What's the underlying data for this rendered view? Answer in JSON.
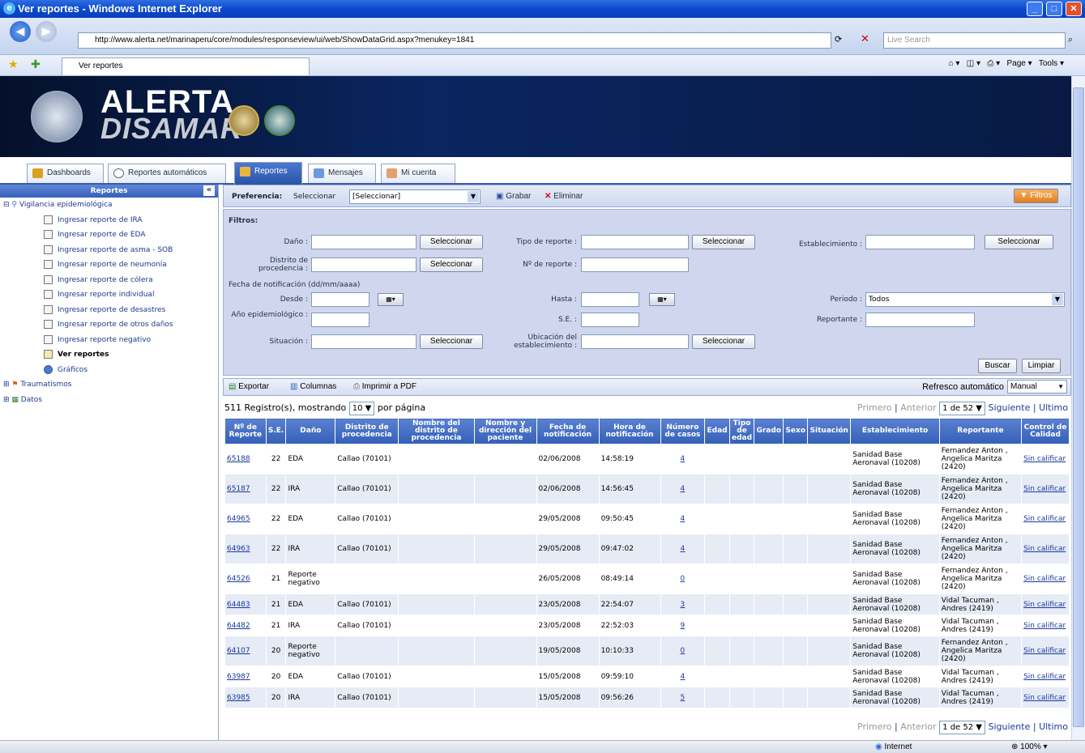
{
  "window": {
    "title": "Ver reportes - Windows Internet Explorer"
  },
  "browser": {
    "url": "http://www.alerta.net/marinaperu/core/modules/responseview/ui/web/ShowDataGrid.aspx?menukey=1841",
    "search_placeholder": "Live Search",
    "tab_title": "Ver reportes",
    "page_menu": "Page",
    "tools_menu": "Tools"
  },
  "banner": {
    "line1": "ALERTA",
    "line2": "DISAMAR"
  },
  "tabs": [
    {
      "label": "Dashboards"
    },
    {
      "label": "Reportes automáticos"
    },
    {
      "label": "Reportes"
    },
    {
      "label": "Mensajes"
    },
    {
      "label": "Mi cuenta"
    }
  ],
  "sidebar": {
    "title": "Reportes",
    "collapse": "«",
    "root": "Vigilancia epidemiológica",
    "items": [
      {
        "label": "Ingresar reporte de IRA"
      },
      {
        "label": "Ingresar reporte de EDA"
      },
      {
        "label": "Ingresar reporte de asma - SOB"
      },
      {
        "label": "Ingresar reporte de neumonía"
      },
      {
        "label": "Ingresar reporte de cólera"
      },
      {
        "label": "Ingresar reporte individual"
      },
      {
        "label": "Ingresar reporte de desastres"
      },
      {
        "label": "Ingresar reporte de otros daños"
      },
      {
        "label": "Ingresar reporte negativo"
      },
      {
        "label": "Ver reportes"
      },
      {
        "label": "Gráficos"
      }
    ],
    "other": [
      {
        "label": "Traumatismos"
      },
      {
        "label": "Datos"
      }
    ]
  },
  "prefs": {
    "label": "Preferencia:",
    "select_label": "Seleccionar",
    "select_value": "[Seleccionar]",
    "save": "Grabar",
    "delete": "Eliminar",
    "filters_btn": "Filtros"
  },
  "filters": {
    "title": "Filtros:",
    "dano": "Daño :",
    "tipo": "Tipo de reporte :",
    "establecimiento": "Establecimiento :",
    "distrito": "Distrito de procedencia :",
    "numero": "Nº de reporte :",
    "fecha_title": "Fecha de notificación (dd/mm/aaaa)",
    "desde": "Desde :",
    "hasta": "Hasta :",
    "periodo": "Periodo :",
    "periodo_value": "Todos",
    "anio": "Año epidemiológico :",
    "se": "S.E. :",
    "reportante": "Reportante :",
    "situacion": "Situación :",
    "ubicacion": "Ubicación del establecimiento :",
    "select_btn": "Seleccionar",
    "search_btn": "Buscar",
    "clear_btn": "Limpiar"
  },
  "toolbar": {
    "export": "Exportar",
    "columns": "Columnas",
    "pdf": "Imprimir a PDF",
    "refresh_label": "Refresco automático",
    "refresh_value": "Manual"
  },
  "pager": {
    "records_prefix": "511 Registro(s), mostrando",
    "page_size": "10",
    "records_suffix": "por página",
    "first": "Primero",
    "prev": "Anterior",
    "page": "1 de 52",
    "next": "Siguiente",
    "last": "Ultimo",
    "sep": "|"
  },
  "table": {
    "headers": [
      "Nº de Reporte",
      "S.E.",
      "Daño",
      "Distrito de procedencia",
      "Nombre del distrito de procedencia",
      "Nombre y dirección del paciente",
      "Fecha de notificación",
      "Hora de notificación",
      "Número de casos",
      "Edad",
      "Tipo de edad",
      "Grado",
      "Sexo",
      "Situación",
      "Establecimiento",
      "Reportante",
      "Control de Calidad"
    ],
    "rows": [
      {
        "id": "65188",
        "se": "22",
        "dano": "EDA",
        "distrito": "Callao (70101)",
        "fecha": "02/06/2008",
        "hora": "14:58:19",
        "casos": "4",
        "est": "Sanidad Base Aeronaval (10208)",
        "rep": "Fernandez Anton , Angelica Maritza (2420)",
        "qc": "Sin calificar"
      },
      {
        "id": "65187",
        "se": "22",
        "dano": "IRA",
        "distrito": "Callao (70101)",
        "fecha": "02/06/2008",
        "hora": "14:56:45",
        "casos": "4",
        "est": "Sanidad Base Aeronaval (10208)",
        "rep": "Fernandez Anton , Angelica Maritza (2420)",
        "qc": "Sin calificar"
      },
      {
        "id": "64965",
        "se": "22",
        "dano": "EDA",
        "distrito": "Callao (70101)",
        "fecha": "29/05/2008",
        "hora": "09:50:45",
        "casos": "4",
        "est": "Sanidad Base Aeronaval (10208)",
        "rep": "Fernandez Anton , Angelica Maritza (2420)",
        "qc": "Sin calificar"
      },
      {
        "id": "64963",
        "se": "22",
        "dano": "IRA",
        "distrito": "Callao (70101)",
        "fecha": "29/05/2008",
        "hora": "09:47:02",
        "casos": "4",
        "est": "Sanidad Base Aeronaval (10208)",
        "rep": "Fernandez Anton , Angelica Maritza (2420)",
        "qc": "Sin calificar"
      },
      {
        "id": "64526",
        "se": "21",
        "dano": "Reporte negativo",
        "distrito": "",
        "fecha": "26/05/2008",
        "hora": "08:49:14",
        "casos": "0",
        "est": "Sanidad Base Aeronaval (10208)",
        "rep": "Fernandez Anton , Angelica Maritza (2420)",
        "qc": "Sin calificar"
      },
      {
        "id": "64483",
        "se": "21",
        "dano": "EDA",
        "distrito": "Callao (70101)",
        "fecha": "23/05/2008",
        "hora": "22:54:07",
        "casos": "3",
        "est": "Sanidad Base Aeronaval (10208)",
        "rep": "Vidal Tacuman , Andres (2419)",
        "qc": "Sin calificar"
      },
      {
        "id": "64482",
        "se": "21",
        "dano": "IRA",
        "distrito": "Callao (70101)",
        "fecha": "23/05/2008",
        "hora": "22:52:03",
        "casos": "9",
        "est": "Sanidad Base Aeronaval (10208)",
        "rep": "Vidal Tacuman , Andres (2419)",
        "qc": "Sin calificar"
      },
      {
        "id": "64107",
        "se": "20",
        "dano": "Reporte negativo",
        "distrito": "",
        "fecha": "19/05/2008",
        "hora": "10:10:33",
        "casos": "0",
        "est": "Sanidad Base Aeronaval (10208)",
        "rep": "Fernandez Anton , Angelica Maritza (2420)",
        "qc": "Sin calificar"
      },
      {
        "id": "63987",
        "se": "20",
        "dano": "EDA",
        "distrito": "Callao (70101)",
        "fecha": "15/05/2008",
        "hora": "09:59:10",
        "casos": "4",
        "est": "Sanidad Base Aeronaval (10208)",
        "rep": "Vidal Tacuman , Andres (2419)",
        "qc": "Sin calificar"
      },
      {
        "id": "63985",
        "se": "20",
        "dano": "IRA",
        "distrito": "Callao (70101)",
        "fecha": "15/05/2008",
        "hora": "09:56:26",
        "casos": "5",
        "est": "Sanidad Base Aeronaval (10208)",
        "rep": "Vidal Tacuman , Andres (2419)",
        "qc": "Sin calificar"
      }
    ]
  },
  "statusbar": {
    "zone": "Internet",
    "zoom": "100%"
  }
}
